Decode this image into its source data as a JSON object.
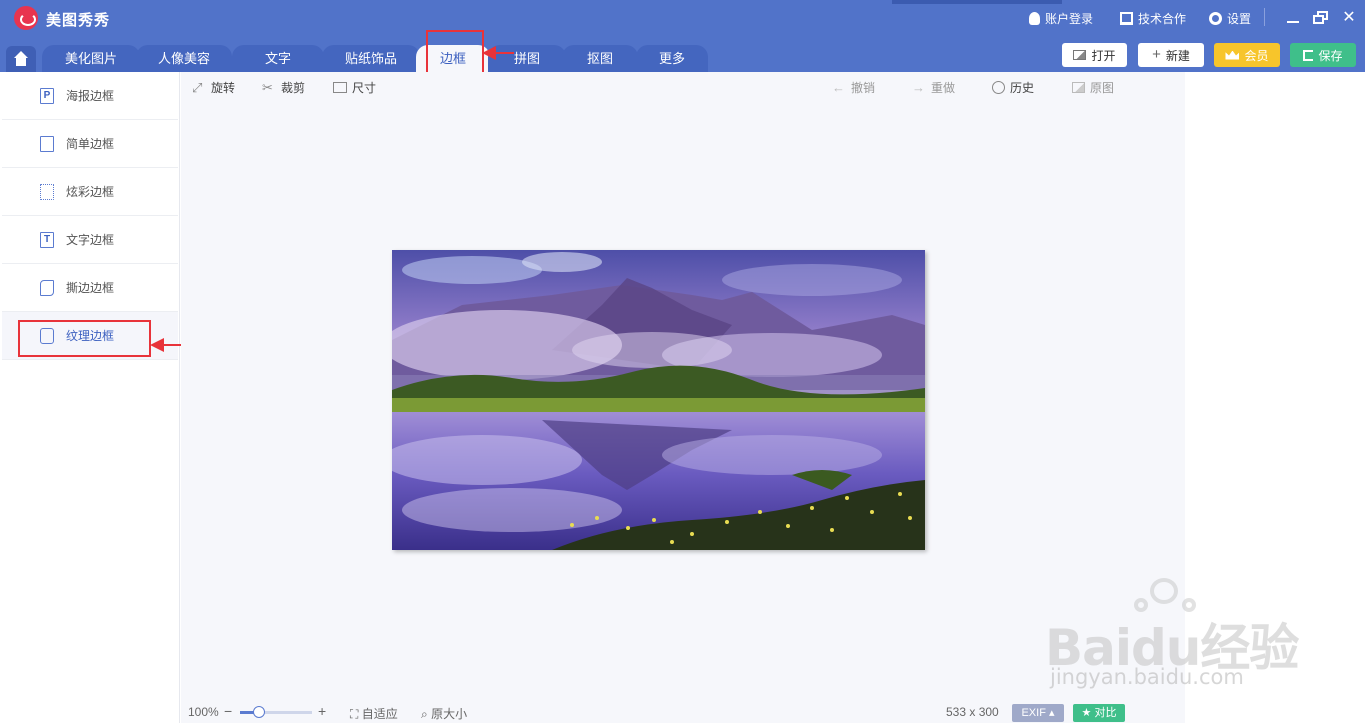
{
  "app": {
    "title": "美图秀秀"
  },
  "titlebar": {
    "account_label": "账户登录",
    "support_label": "技术合作",
    "settings_label": "设置"
  },
  "tabs": [
    {
      "label": "美化图片"
    },
    {
      "label": "人像美容"
    },
    {
      "label": "文字"
    },
    {
      "label": "贴纸饰品"
    },
    {
      "label": "边框",
      "active": true
    },
    {
      "label": "拼图"
    },
    {
      "label": "抠图"
    },
    {
      "label": "更多"
    }
  ],
  "actions": {
    "open_label": "打开",
    "new_label": "新建",
    "vip_label": "会员",
    "save_label": "保存"
  },
  "sidebar": {
    "items": [
      {
        "label": "海报边框",
        "icon": "poster-frame-icon",
        "glyph": "P"
      },
      {
        "label": "简单边框",
        "icon": "simple-frame-icon",
        "glyph": ""
      },
      {
        "label": "炫彩边框",
        "icon": "colorful-frame-icon",
        "glyph": ""
      },
      {
        "label": "文字边框",
        "icon": "text-frame-icon",
        "glyph": "T"
      },
      {
        "label": "撕边边框",
        "icon": "torn-edge-frame-icon",
        "glyph": ""
      },
      {
        "label": "纹理边框",
        "icon": "texture-frame-icon",
        "glyph": "",
        "selected": true
      }
    ]
  },
  "toolbar": {
    "rotate_label": "旋转",
    "crop_label": "裁剪",
    "size_label": "尺寸",
    "undo_label": "撤销",
    "redo_label": "重做",
    "history_label": "历史",
    "original_label": "原图"
  },
  "statusbar": {
    "zoom_text": "100%",
    "zoom_level": 0.25,
    "fit_label": "自适应",
    "actual_size_label": "原大小",
    "dimensions": "533 x 300",
    "exif_label": "EXIF",
    "compare_label": "对比"
  },
  "watermark": {
    "brand": "Baidu",
    "suffix": "经验",
    "url": "jingyan.baidu.com"
  },
  "colors": {
    "titlebar": "#5173c9",
    "accent": "#3d61c0",
    "highlight": "#e8333a",
    "vip": "#f7c52b",
    "save": "#3fbf8a",
    "exif_badge": "#9fa9c9",
    "compare_badge": "#3fbf8a"
  }
}
